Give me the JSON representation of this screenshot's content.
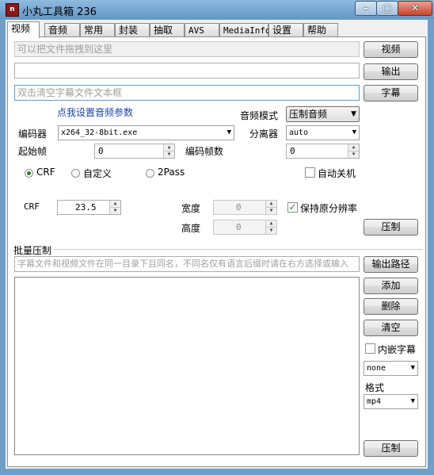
{
  "window": {
    "title": "小丸工具箱 236",
    "app_icon_letter": "n"
  },
  "tabs": [
    "视频",
    "音频",
    "常用",
    "封装",
    "抽取",
    "AVS",
    "MediaInfo",
    "设置",
    "帮助"
  ],
  "video": {
    "drop_placeholder": "可以把文件拖拽到这里",
    "video_button": "视频",
    "output_value": "",
    "output_button": "输出",
    "subtitle_placeholder": "双击清空字幕文件文本框",
    "subtitle_button": "字幕",
    "audio_settings_link": "点我设置音频参数",
    "audio_mode_label": "音频模式",
    "audio_mode_value": "压制音频",
    "encoder_label": "编码器",
    "encoder_value": "x264_32-8bit.exe",
    "splitter_label": "分离器",
    "splitter_value": "auto",
    "start_frame_label": "起始帧",
    "start_frame_value": "0",
    "encode_frames_label": "编码帧数",
    "encode_frames_value": "0",
    "mode_crf": "CRF",
    "mode_custom": "自定义",
    "mode_2pass": "2Pass",
    "auto_shutdown_label": "自动关机",
    "crf_label": "CRF",
    "crf_value": "23.5",
    "width_label": "宽度",
    "width_value": "0",
    "height_label": "高度",
    "height_value": "0",
    "keep_resolution_label": "保持原分辨率",
    "encode_button": "压制"
  },
  "batch": {
    "group_label": "批量压制",
    "hint_placeholder": "字幕文件和视频文件在同一目录下且同名，不同名仅有语言后缀时请在右方选择或输入",
    "output_path_button": "输出路径",
    "add_button": "添加",
    "delete_button": "删除",
    "clear_button": "清空",
    "embed_subtitle_label": "内嵌字幕",
    "subtitle_lang_value": "none",
    "format_label": "格式",
    "format_value": "mp4",
    "encode_button": "压制"
  }
}
